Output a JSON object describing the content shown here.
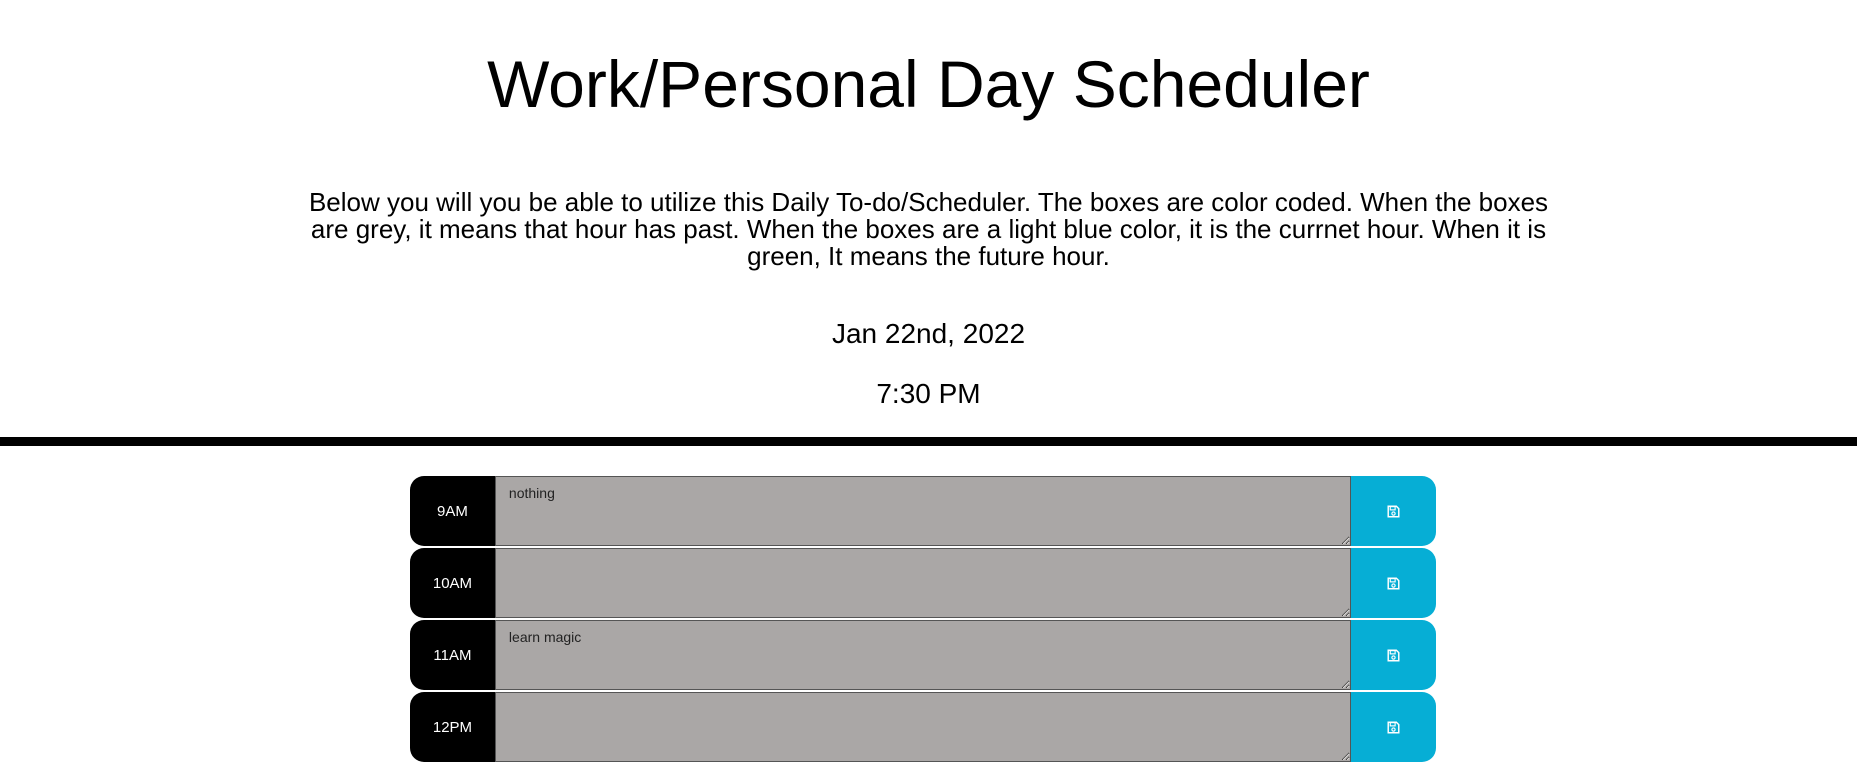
{
  "header": {
    "title": "Work/Personal Day Scheduler",
    "description": "Below you will you be able to utilize this Daily To-do/Scheduler. The boxes are color coded. When the boxes are grey, it means that hour has past. When the boxes are a light blue color, it is the currnet hour. When it is green, It means the future hour.",
    "date": "Jan 22nd, 2022",
    "time": "7:30 PM"
  },
  "colors": {
    "past": "#aaa7a6",
    "save_button": "#06aed5",
    "hour_label_bg": "#000000"
  },
  "schedule": [
    {
      "hour": "9AM",
      "text": "nothing",
      "status": "past",
      "save_icon": "floppy-disk-icon"
    },
    {
      "hour": "10AM",
      "text": "",
      "status": "past",
      "save_icon": "floppy-disk-icon"
    },
    {
      "hour": "11AM",
      "text": "learn magic",
      "status": "past",
      "save_icon": "floppy-disk-icon"
    },
    {
      "hour": "12PM",
      "text": "",
      "status": "past",
      "save_icon": "floppy-disk-icon"
    }
  ]
}
